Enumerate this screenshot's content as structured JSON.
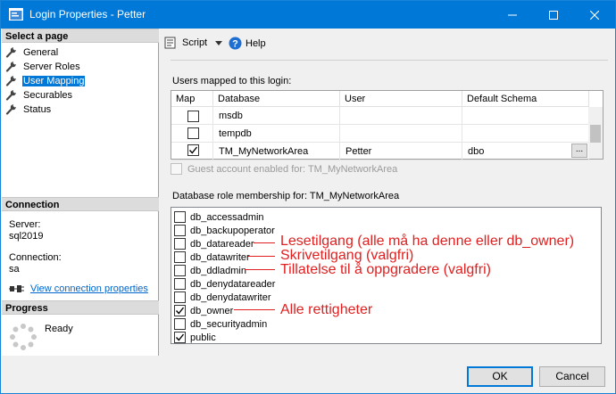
{
  "window": {
    "title": "Login Properties - Petter",
    "controls": [
      "minimize-icon",
      "maximize-icon",
      "close-icon"
    ]
  },
  "left_pane": {
    "select_page_header": "Select a page",
    "pages": [
      {
        "label": "General",
        "icon": "wrench-icon",
        "selected": false
      },
      {
        "label": "Server Roles",
        "icon": "wrench-icon",
        "selected": false
      },
      {
        "label": "User Mapping",
        "icon": "wrench-icon",
        "selected": true
      },
      {
        "label": "Securables",
        "icon": "wrench-icon",
        "selected": false
      },
      {
        "label": "Status",
        "icon": "wrench-icon",
        "selected": false
      }
    ],
    "connection_header": "Connection",
    "server_label": "Server:",
    "server_value": "sql2019",
    "connection_label": "Connection:",
    "connection_value": "sa",
    "view_connection_link": "View connection properties",
    "progress_header": "Progress",
    "progress_status": "Ready"
  },
  "toolbar": {
    "script_label": "Script",
    "help_label": "Help"
  },
  "mapping": {
    "title": "Users mapped to this login:",
    "columns": [
      "Map",
      "Database",
      "User",
      "Default Schema"
    ],
    "rows": [
      {
        "map": false,
        "database": "msdb",
        "user": "",
        "schema": ""
      },
      {
        "map": false,
        "database": "tempdb",
        "user": "",
        "schema": ""
      },
      {
        "map": true,
        "database": "TM_MyNetworkArea",
        "user": "Petter",
        "schema": "dbo"
      }
    ],
    "ellipsis": "...",
    "guest_label": "Guest account enabled for: TM_MyNetworkArea"
  },
  "roles": {
    "title": "Database role membership for: TM_MyNetworkArea",
    "items": [
      {
        "name": "db_accessadmin",
        "checked": false
      },
      {
        "name": "db_backupoperator",
        "checked": false
      },
      {
        "name": "db_datareader",
        "checked": false
      },
      {
        "name": "db_datawriter",
        "checked": false
      },
      {
        "name": "db_ddladmin",
        "checked": false
      },
      {
        "name": "db_denydatareader",
        "checked": false
      },
      {
        "name": "db_denydatawriter",
        "checked": false
      },
      {
        "name": "db_owner",
        "checked": true
      },
      {
        "name": "db_securityadmin",
        "checked": false
      },
      {
        "name": "public",
        "checked": true
      }
    ]
  },
  "annotations": {
    "datareader": "Lesetilgang (alle må ha denne eller db_owner)",
    "datawriter": "Skrivetilgang (valgfri)",
    "ddladmin": "Tillatelse til å oppgradere (valgfri)",
    "owner": "Alle rettigheter",
    "color": "#e02020"
  },
  "buttons": {
    "ok": "OK",
    "cancel": "Cancel"
  },
  "colors": {
    "titlebar": "#0078d7",
    "selection": "#0078d7",
    "link": "#0066cc"
  }
}
